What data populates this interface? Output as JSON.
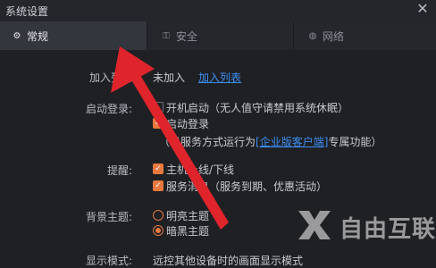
{
  "window": {
    "title": "系统设置"
  },
  "tabs": [
    {
      "label": "常规",
      "icon": "gear-icon"
    },
    {
      "label": "安全",
      "icon": "shield-icon"
    },
    {
      "label": "网络",
      "icon": "globe-icon"
    }
  ],
  "settings": {
    "join_list": {
      "label": "加入列表",
      "value": "未加入",
      "link": "加入列表"
    },
    "startup": {
      "label": "启动登录:",
      "boot_start": {
        "label": "开机启动（无人值守请禁用系统休眠）",
        "checked": false
      },
      "auto_login": {
        "label": "启动登录",
        "checked": true
      },
      "note_prefix": "（以服务方式运行为",
      "note_link": "[企业版客户端]",
      "note_suffix": "专属功能）"
    },
    "reminders": {
      "label": "提醒:",
      "host_online": {
        "label": "主机上线/下线",
        "checked": true
      },
      "service_msg": {
        "label": "服务消息（服务到期、优惠活动）",
        "checked": true
      }
    },
    "theme": {
      "label": "背景主题:",
      "options": [
        {
          "label": "明亮主题",
          "selected": false
        },
        {
          "label": "暗黑主题",
          "selected": true
        }
      ]
    },
    "display_mode": {
      "label": "显示模式:",
      "text": "远控其他设备时的画面显示模式"
    }
  },
  "watermark": {
    "text": "自由互联"
  },
  "colors": {
    "accent": "#e8793e",
    "link": "#3d8ef2",
    "arrow": "#e0242b"
  }
}
